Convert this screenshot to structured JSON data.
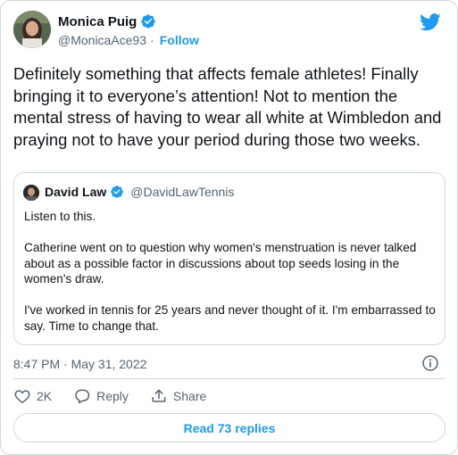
{
  "author": {
    "name": "Monica Puig",
    "handle": "@MonicaAce93",
    "follow_label": "Follow",
    "separator": "·"
  },
  "tweet": {
    "text": "Definitely something that affects female athletes! Finally bringing it to everyone’s attention! Not to mention the mental stress of having to wear all white at Wimbledon and praying not to have your period during those two weeks."
  },
  "quoted_tweet": {
    "name": "David Law",
    "handle": "@DavidLawTennis",
    "paragraphs": [
      "Listen to this.",
      "Catherine went on to question why women's menstruation is never talked about as a possible factor in discussions about top seeds losing in the women's draw.",
      "I've worked in tennis for 25 years and never thought of it. I'm embarrassed to say. Time to change that."
    ]
  },
  "meta": {
    "timestamp": "8:47 PM · May 31, 2022"
  },
  "actions": {
    "like_count": "2K",
    "reply_label": "Reply",
    "share_label": "Share"
  },
  "footer": {
    "read_replies_label": "Read 73 replies"
  },
  "colors": {
    "accent": "#1d9bf0",
    "text": "#0f1419",
    "muted": "#536471",
    "border": "#cfd9de"
  },
  "icons": [
    "verified-badge-icon",
    "twitter-bird-icon",
    "info-icon",
    "heart-icon",
    "reply-icon",
    "share-icon"
  ]
}
